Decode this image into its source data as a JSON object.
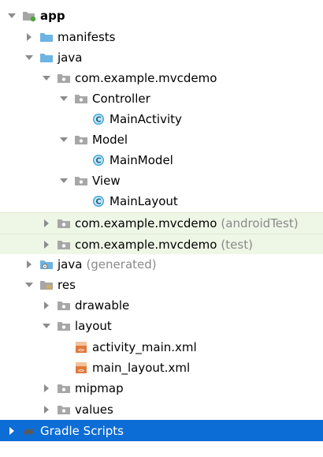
{
  "tree": {
    "app": "app",
    "manifests": "manifests",
    "java": "java",
    "package_main": "com.example.mvcdemo",
    "controller": "Controller",
    "main_activity": "MainActivity",
    "model": "Model",
    "main_model": "MainModel",
    "view": "View",
    "main_layout": "MainLayout",
    "package_android_test": "com.example.mvcdemo",
    "android_test_suffix": "(androidTest)",
    "package_test": "com.example.mvcdemo",
    "test_suffix": "(test)",
    "java_generated": "java",
    "generated_suffix": "(generated)",
    "res": "res",
    "drawable": "drawable",
    "layout": "layout",
    "activity_main_xml": "activity_main.xml",
    "main_layout_xml": "main_layout.xml",
    "mipmap": "mipmap",
    "values": "values",
    "gradle_scripts": "Gradle Scripts"
  },
  "icons": {
    "module": "module-folder-icon",
    "folder": "folder-icon",
    "package": "package-icon",
    "class": "class-icon",
    "xml": "xml-file-icon",
    "gradle": "gradle-icon"
  },
  "colors": {
    "folder_blue": "#6cb4e4",
    "package_gray": "#a7a7a7",
    "class_teal": "#3aa7d9",
    "test_row_bg": "#eef6e6",
    "selection_blue": "#0d6dd6",
    "xml_orange": "#e0793c"
  }
}
